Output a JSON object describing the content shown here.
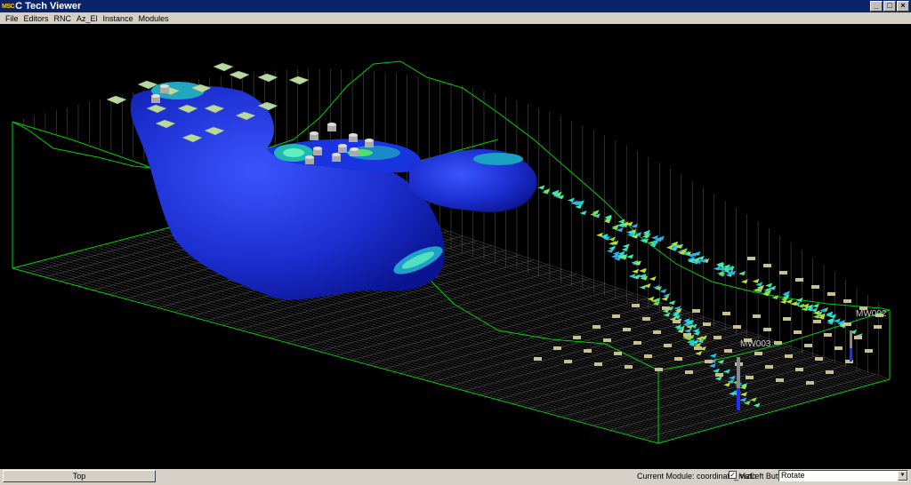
{
  "window": {
    "logo": "MSC",
    "title": "C Tech Viewer",
    "minimize_glyph": "_",
    "maximize_glyph": "□",
    "close_glyph": "×"
  },
  "menu": {
    "items": [
      "File",
      "Editors",
      "RNC",
      "Az_El",
      "Instance",
      "Modules"
    ]
  },
  "viewport": {
    "well_labels": [
      "MW002",
      "MW003"
    ]
  },
  "statusbar": {
    "top_button": "Top",
    "current_module": "Current Module: coordinate_math",
    "checkbox_checked": true,
    "checkbox_glyph": "✓",
    "left_button_label": "VizLeft Button",
    "mode_value": "Rotate",
    "dropdown_icon": "chevron-down-icon"
  },
  "colors": {
    "title_bar": "#0a246a",
    "viewport_bg": "#000000",
    "wireframe": "#00d000",
    "plume": "#1c2fd0"
  }
}
